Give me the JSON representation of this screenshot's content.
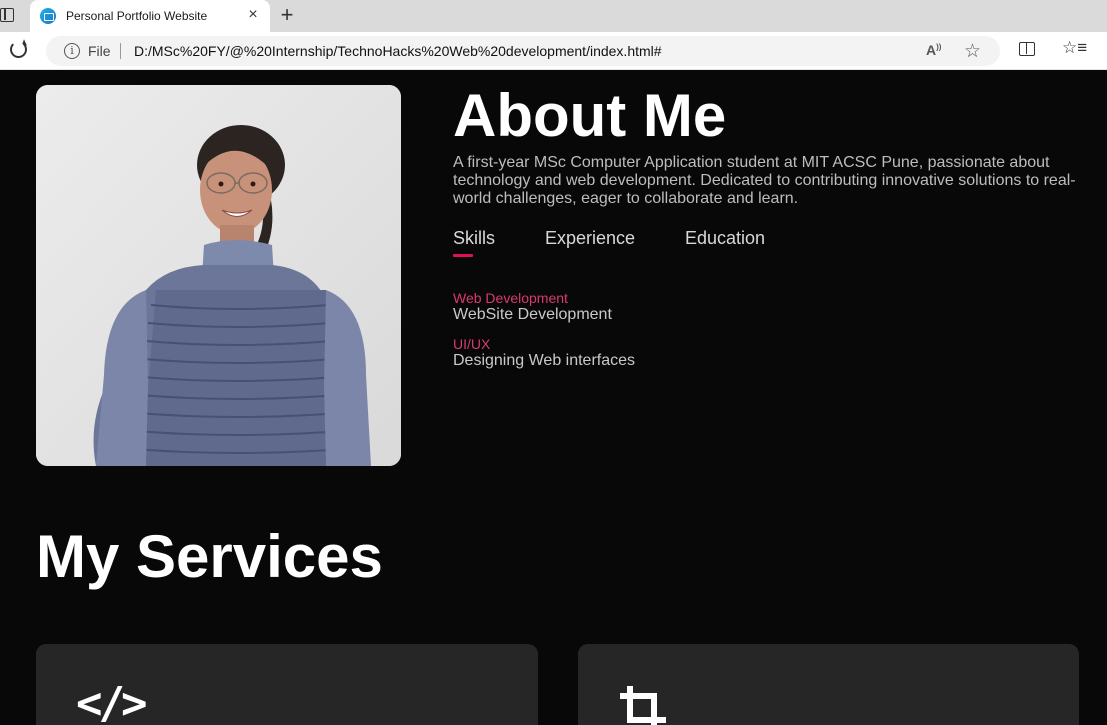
{
  "browser": {
    "tab_title": "Personal Portfolio Website",
    "tab_close": "×",
    "new_tab": "+",
    "file_label": "File",
    "url": "D:/MSc%20FY/@%20Internship/TechnoHacks%20Web%20development/index.html#",
    "read_aloud": "Ȃ"
  },
  "about": {
    "title": "About Me",
    "description": "A first-year MSc Computer Application student at MIT ACSC Pune, passionate about technology and web development. Dedicated to contributing innovative solutions to real-world challenges, eager to collaborate and learn.",
    "tabs": [
      {
        "label": "Skills",
        "active": true
      },
      {
        "label": "Experience",
        "active": false
      },
      {
        "label": "Education",
        "active": false
      }
    ],
    "skills": [
      {
        "category": "Web Development",
        "description": "WebSite Development"
      },
      {
        "category": "UI/UX",
        "description": "Designing Web interfaces"
      }
    ]
  },
  "services": {
    "title": "My Services",
    "cards": [
      {
        "icon": "code-icon",
        "icon_glyph": "</>"
      },
      {
        "icon": "crop-icon"
      }
    ]
  },
  "colors": {
    "accent": "#e01054",
    "skill_category": "#d83a6c",
    "background": "#080808",
    "card": "#262626"
  }
}
